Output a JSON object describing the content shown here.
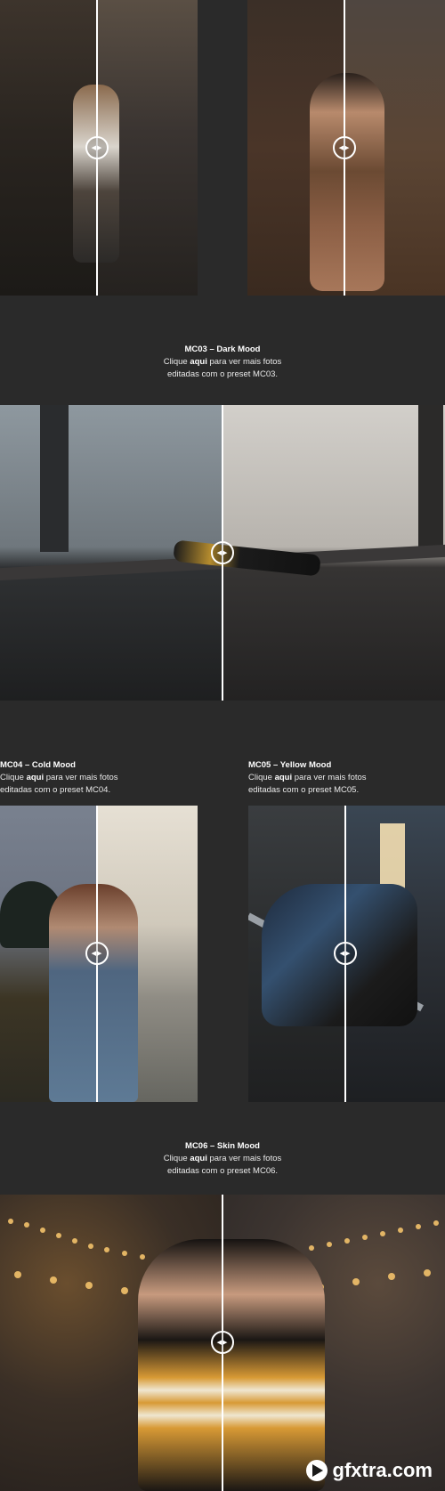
{
  "comparisons": [
    {
      "id": "mc02-left-photo",
      "subject": "woman in kitchen"
    },
    {
      "id": "mc02-right-photo",
      "subject": "smiling woman on sofa"
    },
    {
      "id": "mc03-photo",
      "subject": "person lying on railway tracks in fog"
    },
    {
      "id": "mc04-photo",
      "subject": "woman in blue coat, windy"
    },
    {
      "id": "mc05-photo",
      "subject": "woman sliding on stair railing"
    },
    {
      "id": "mc06-photo",
      "subject": "woman with striped sweater at carousel"
    }
  ],
  "captions": {
    "mc03": {
      "title": "MC03 – Dark Mood",
      "line1_pre": "Clique ",
      "line1_link": "aqui",
      "line1_post": " para ver mais fotos",
      "line2": "editadas com o preset MC03."
    },
    "mc04": {
      "title": "MC04 – Cold Mood",
      "line1_pre": "Clique ",
      "line1_link": "aqui",
      "line1_post": " para ver mais fotos",
      "line2": "editadas com o preset MC04."
    },
    "mc05": {
      "title": "MC05 – Yellow Mood",
      "line1_pre": "Clique ",
      "line1_link": "aqui",
      "line1_post": " para ver mais fotos",
      "line2": "editadas com o preset MC05."
    },
    "mc06": {
      "title": "MC06 – Skin Mood",
      "line1_pre": "Clique ",
      "line1_link": "aqui",
      "line1_post": " para ver mais fotos",
      "line2": "editadas com o preset MC06."
    }
  },
  "handle_icon": "left-right-arrows-icon",
  "handle_glyph": "◀▶",
  "watermark": {
    "text": "gfxtra.com",
    "icon": "play-circle-icon"
  },
  "colors": {
    "background": "#2a2a2a",
    "text": "#ffffff",
    "divider": "#ffffff"
  }
}
